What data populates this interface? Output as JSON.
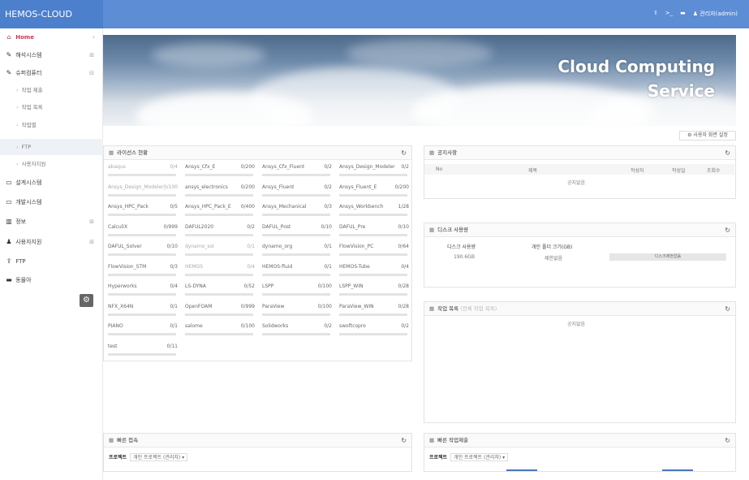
{
  "app": {
    "brand": "HEMOS-CLOUD"
  },
  "topbar": {
    "icons": [
      "upload-icon",
      "terminal-icon",
      "folder-icon"
    ],
    "user_label": "관리자(admin)"
  },
  "sidebar": {
    "items": [
      {
        "label": "Home",
        "icon": "home-icon",
        "active": true
      },
      {
        "label": "해석시스템",
        "icon": "edit-icon",
        "chevron": "⊞"
      },
      {
        "label": "슈퍼컴퓨터",
        "icon": "edit-icon",
        "chevron": "⊟"
      },
      {
        "label": "작업 제출",
        "sub": true
      },
      {
        "label": "작업 목록",
        "sub": true
      },
      {
        "label": "작업별",
        "sub": true
      },
      {
        "label": "FTP",
        "sub": true,
        "selected": true
      },
      {
        "label": "사용자지원",
        "sub": true
      },
      {
        "label": "설계시스템",
        "icon": "monitor-icon"
      },
      {
        "label": "개발시스템",
        "icon": "monitor-icon"
      },
      {
        "label": "정보",
        "icon": "chart-icon",
        "chevron": "⊞"
      },
      {
        "label": "사용자지원",
        "icon": "user-icon",
        "chevron": "⊞"
      },
      {
        "label": "FTP",
        "icon": "upload-icon"
      },
      {
        "label": "동몰아",
        "icon": "folder-icon"
      }
    ]
  },
  "banner": {
    "title_line1": "Cloud Computing",
    "title_line2": "Service"
  },
  "user_setting_label": "사용자 화면 설정",
  "license_panel": {
    "title": "라이선스 현황",
    "items": [
      {
        "name": "abaqus",
        "count": "0/4",
        "blur": true
      },
      {
        "name": "Ansys_Cfx_E",
        "count": "0/200"
      },
      {
        "name": "Ansys_Cfx_Fluent",
        "count": "0/2"
      },
      {
        "name": "Ansys_Design_Modeler",
        "count": "0/2"
      },
      {
        "name": "Ansys_Design_Modeler_E",
        "count": "0/100",
        "blur": true
      },
      {
        "name": "ansys_electronics",
        "count": "0/200"
      },
      {
        "name": "Ansys_Fluent",
        "count": "0/2"
      },
      {
        "name": "Ansys_Fluent_E",
        "count": "0/200"
      },
      {
        "name": "Ansys_HPC_Pack",
        "count": "0/5"
      },
      {
        "name": "Ansys_HPC_Pack_E",
        "count": "0/400"
      },
      {
        "name": "Ansys_Mechanical",
        "count": "0/3"
      },
      {
        "name": "Ansys_Workbench",
        "count": "1/28"
      },
      {
        "name": "CalculiX",
        "count": "0/999"
      },
      {
        "name": "DAFUL2020",
        "count": "0/2"
      },
      {
        "name": "DAFUL_Post",
        "count": "0/10"
      },
      {
        "name": "DAFUL_Pre",
        "count": "0/10"
      },
      {
        "name": "DAFUL_Solver",
        "count": "0/10"
      },
      {
        "name": "dynamo_sol",
        "count": "0/1",
        "blur": true
      },
      {
        "name": "dynamo_org",
        "count": "0/1"
      },
      {
        "name": "FlowVision_PC",
        "count": "0/64"
      },
      {
        "name": "FlowVision_STM",
        "count": "0/3"
      },
      {
        "name": "HEMOS",
        "count": "0/4",
        "blur": true
      },
      {
        "name": "HEMOS-fluid",
        "count": "0/1"
      },
      {
        "name": "HEMOS-Tube",
        "count": "0/4"
      },
      {
        "name": "Hyperworks",
        "count": "0/4"
      },
      {
        "name": "LS-DYNA",
        "count": "0/52"
      },
      {
        "name": "LSPP",
        "count": "0/100"
      },
      {
        "name": "LSPP_WIN",
        "count": "0/28"
      },
      {
        "name": "NFX_X64N",
        "count": "0/1"
      },
      {
        "name": "OpenFOAM",
        "count": "0/999"
      },
      {
        "name": "ParaView",
        "count": "0/100"
      },
      {
        "name": "ParaView_WIN",
        "count": "0/28"
      },
      {
        "name": "PIANO",
        "count": "0/1"
      },
      {
        "name": "salome",
        "count": "0/100"
      },
      {
        "name": "Solidworks",
        "count": "0/2"
      },
      {
        "name": "swoftcopro",
        "count": "0/2"
      },
      {
        "name": "test",
        "count": "0/11"
      }
    ]
  },
  "notice_panel": {
    "title": "공지사항",
    "columns": [
      "No",
      "제목",
      "작성자",
      "작성일",
      "조회수"
    ],
    "empty_text": "공지없음"
  },
  "disk_panel": {
    "title": "디스크 사용량",
    "columns": [
      "디스크 사용량",
      "개인 폴더 크기(GB)"
    ],
    "row": {
      "usage": "190.6GB",
      "folder": "제한없음",
      "bar_label": "디스크제한없음"
    }
  },
  "job_panel": {
    "title": "작업 목록",
    "subtitle": "(전체 작업 목록)",
    "empty_text": "공지없음"
  },
  "quick_access": {
    "title": "빠른 접속",
    "project_label": "프로젝트",
    "project_value": "개인 프로젝트 (관리자) ▾"
  },
  "quick_submit": {
    "title": "빠른 작업제출",
    "project_label": "프로젝트",
    "project_value": "개인 프로젝트 (관리자) ▾"
  }
}
